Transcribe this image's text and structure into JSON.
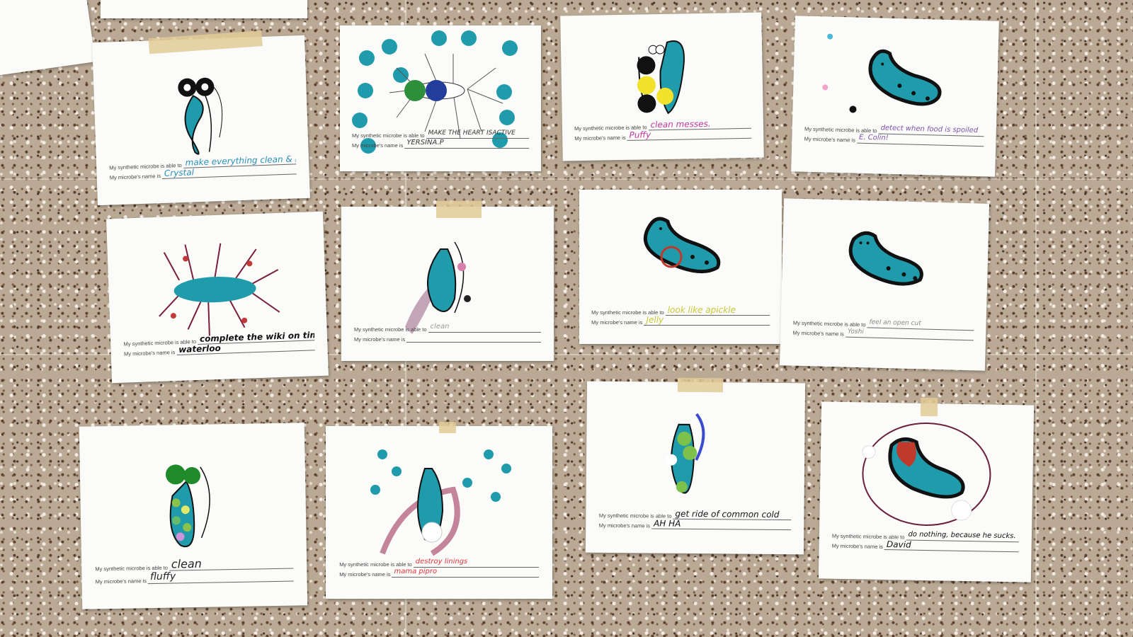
{
  "form": {
    "able_label": "My synthetic microbe is able to",
    "name_label": "My microbe's name is"
  },
  "colors": {
    "teal": "#1f9bab",
    "floor": "#b9a995",
    "paper": "#fbfbf9",
    "tape": "#e2cb96"
  },
  "sheets": [
    {
      "able": "make everything clean & healthy",
      "name": "Crystal",
      "ink": "#2a8fb8"
    },
    {
      "able": "MAKE THE HEART ISACTIVE",
      "name": "YERSINA.P",
      "ink": "#333333"
    },
    {
      "able": "clean messes.",
      "name": "Puffy",
      "ink": "#c0389a"
    },
    {
      "able": "detect when food is spoiled",
      "name": "E. Colin!",
      "ink": "#7a4fa8"
    },
    {
      "able": "complete the wiki on time",
      "name": "waterloo",
      "ink": "#111111"
    },
    {
      "able": "clean",
      "name": "",
      "ink": "#9a9a9a"
    },
    {
      "able": "look like apickle",
      "name": "Jelly",
      "ink": "#c7c83a"
    },
    {
      "able": "feel an open cut",
      "name": "Yoshi",
      "ink": "#8a8a8a"
    },
    {
      "able": "clean",
      "name": "fluffy",
      "ink": "#222222"
    },
    {
      "able": "destroy linings",
      "name": "mama pipro",
      "ink": "#e0343a"
    },
    {
      "able": "get ride of common cold",
      "name": "AH HA",
      "ink": "#111111"
    },
    {
      "able": "do nothing, because he sucks.",
      "name": "David",
      "ink": "#111111"
    }
  ]
}
